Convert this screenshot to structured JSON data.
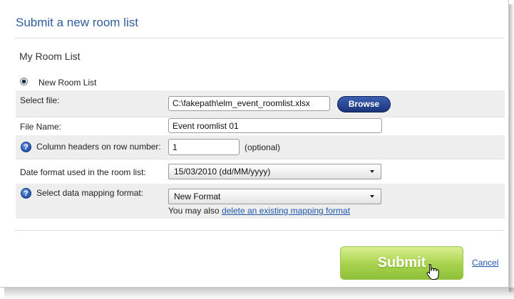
{
  "dialog": {
    "title": "Submit a new room list"
  },
  "section": {
    "title": "My Room List"
  },
  "source_option": {
    "label": "New Room List",
    "selected": true
  },
  "form": {
    "select_file": {
      "label": "Select file:",
      "value": "C:\\fakepath\\elm_event_roomlist.xlsx",
      "browse_label": "Browse"
    },
    "file_name": {
      "label": "File Name:",
      "value": "Event roomlist 01"
    },
    "column_headers": {
      "label": "Column headers on row number:",
      "value": "1",
      "hint": "(optional)"
    },
    "date_format": {
      "label": "Date format used in the room list:",
      "value": "15/03/2010 (dd/MM/yyyy)"
    },
    "mapping_format": {
      "label": "Select data mapping format:",
      "value": "New Format",
      "note": "You may also",
      "link": "delete an existing mapping format"
    }
  },
  "actions": {
    "submit": "Submit",
    "cancel": "Cancel"
  },
  "icons": {
    "help": "help-icon",
    "cursor": "hand-pointer-icon"
  },
  "colors": {
    "title": "#2f5e99",
    "browse": "#1b3479",
    "submit": "#a8d24c",
    "link": "#1f57a8"
  }
}
